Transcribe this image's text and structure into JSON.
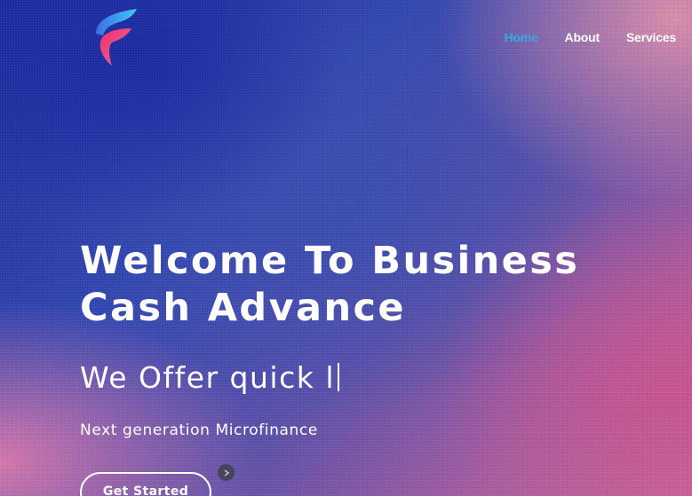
{
  "nav": {
    "items": [
      {
        "label": "Home",
        "active": true
      },
      {
        "label": "About",
        "active": false
      },
      {
        "label": "Services",
        "active": false
      }
    ]
  },
  "hero": {
    "title_line1": "Welcome To Business",
    "title_line2": "Cash Advance",
    "typed_text": "We Offer quick l",
    "subtitle": "Next generation Microfinance",
    "cta_label": "Get Started"
  },
  "colors": {
    "accent": "#3aa8e0",
    "text": "#ffffff"
  },
  "icons": {
    "logo": "brand-logo-icon",
    "next": "chevron-right-icon"
  }
}
